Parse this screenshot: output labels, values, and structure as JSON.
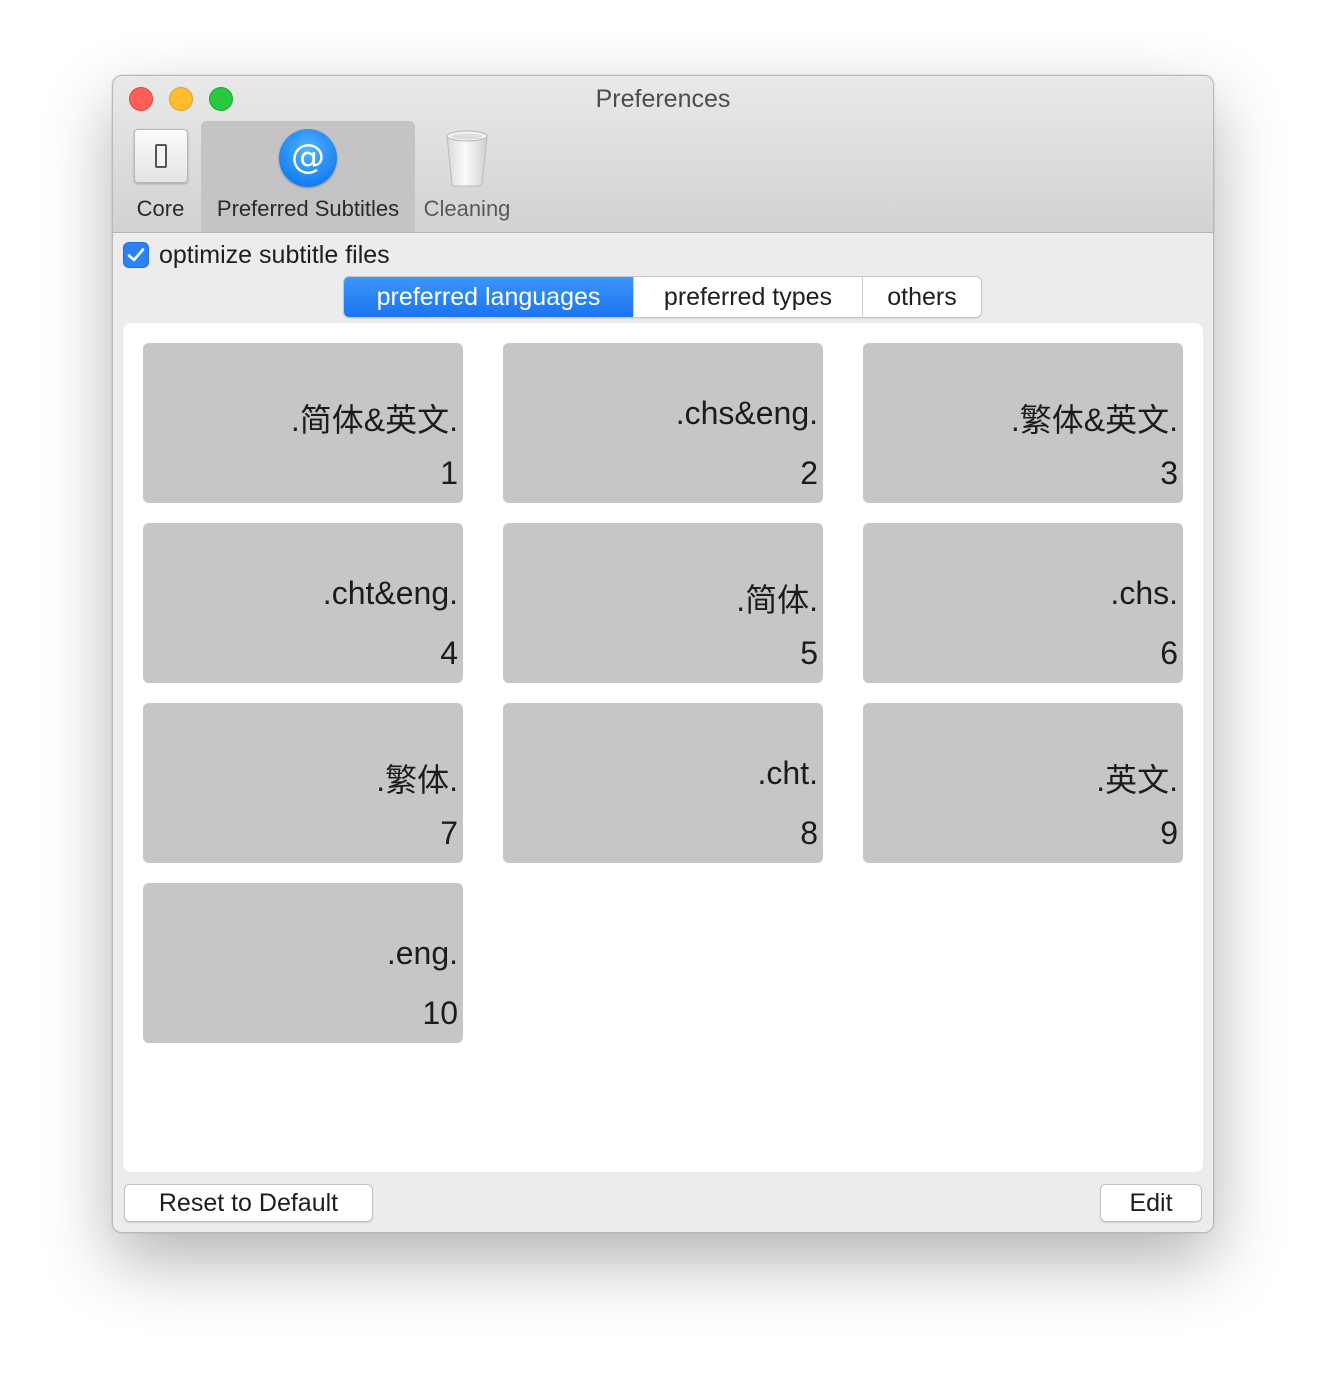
{
  "window": {
    "title": "Preferences"
  },
  "toolbar": {
    "items": [
      {
        "label": "Core",
        "icon": "switch-icon"
      },
      {
        "label": "Preferred Subtitles",
        "icon": "at-sign-icon",
        "active": true
      },
      {
        "label": "Cleaning",
        "icon": "trash-icon"
      }
    ]
  },
  "options": {
    "optimize_label": "optimize subtitle files",
    "optimize_checked": true
  },
  "segments": [
    {
      "label": "preferred languages",
      "selected": true
    },
    {
      "label": "preferred types",
      "selected": false
    },
    {
      "label": "others",
      "selected": false
    }
  ],
  "languages": [
    {
      "label": ".简体&英文.",
      "rank": "1"
    },
    {
      "label": ".chs&eng.",
      "rank": "2"
    },
    {
      "label": ".繁体&英文.",
      "rank": "3"
    },
    {
      "label": ".cht&eng.",
      "rank": "4"
    },
    {
      "label": ".简体.",
      "rank": "5"
    },
    {
      "label": ".chs.",
      "rank": "6"
    },
    {
      "label": ".繁体.",
      "rank": "7"
    },
    {
      "label": ".cht.",
      "rank": "8"
    },
    {
      "label": ".英文.",
      "rank": "9"
    },
    {
      "label": ".eng.",
      "rank": "10"
    }
  ],
  "buttons": {
    "reset_label": "Reset to Default",
    "edit_label": "Edit"
  },
  "colors": {
    "accent": "#1b74ee",
    "tile": "#c6c6c8",
    "close": "#fe5f57",
    "minimize": "#febc2e",
    "zoom": "#28c840"
  }
}
